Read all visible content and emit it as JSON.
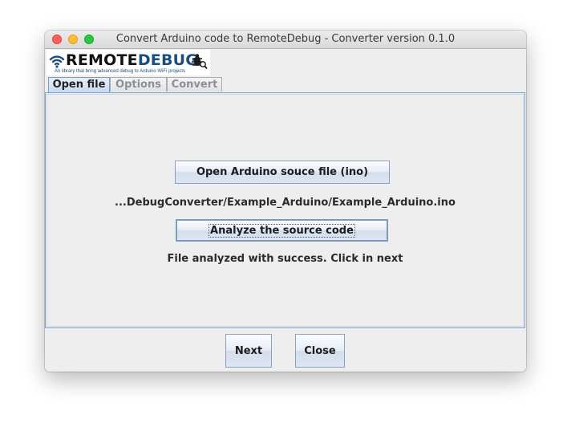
{
  "window": {
    "title": "Convert Arduino code to RemoteDebug - Converter version 0.1.0"
  },
  "logo": {
    "brand_part1": "REMOTE",
    "brand_part2": "DEBUG",
    "tagline": "An library that bring advanced debug to Arduino WiFi projects",
    "brand_color": "#1a4f7d"
  },
  "tabs": [
    {
      "label": "Open file",
      "active": true
    },
    {
      "label": "Options",
      "active": false
    },
    {
      "label": "Convert",
      "active": false
    }
  ],
  "open_file_panel": {
    "open_button_label": "Open Arduino souce file (ino)",
    "file_path": "...DebugConverter/Example_Arduino/Example_Arduino.ino",
    "analyze_button_label": "Analyze the source code",
    "status_message": "File analyzed with success. Click in next"
  },
  "footer": {
    "next_label": "Next",
    "close_label": "Close"
  },
  "icons": {
    "window_close": "close-icon",
    "window_minimize": "minimize-icon",
    "window_zoom": "zoom-icon",
    "logo_wifi": "wifi-icon",
    "logo_bug": "bug-icon"
  },
  "colors": {
    "traffic_red": "#fe5f57",
    "traffic_yellow": "#febc2e",
    "traffic_green": "#28c840",
    "panel_border": "#7aa1cf"
  }
}
